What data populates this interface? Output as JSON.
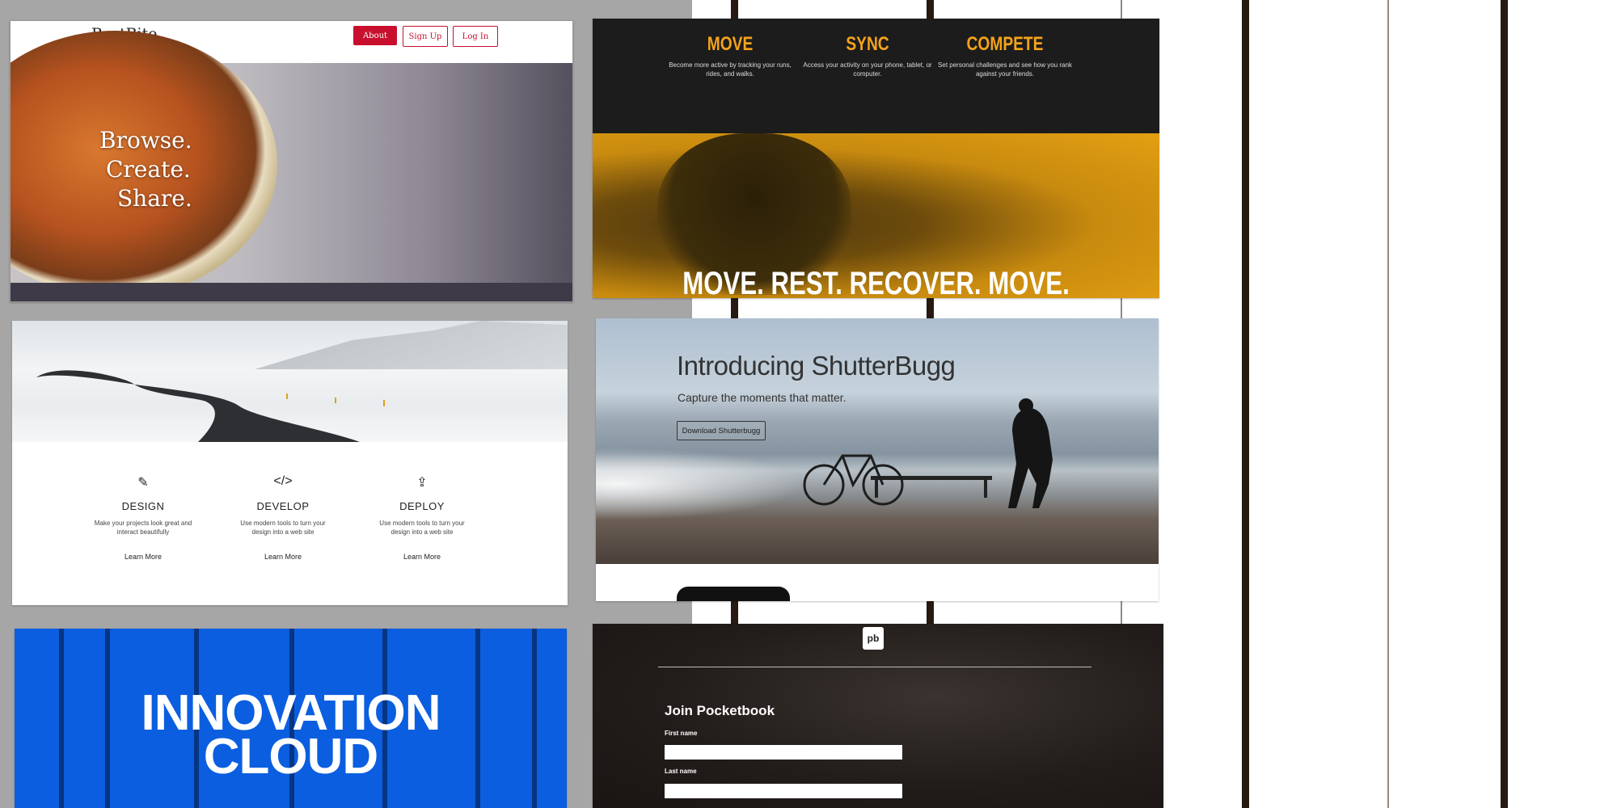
{
  "bestbite": {
    "brand": "BestBite",
    "nav": {
      "about": "About",
      "signup": "Sign Up",
      "login": "Log In"
    },
    "slogan": [
      "Browse.",
      "Create.",
      "Share."
    ]
  },
  "fitness": {
    "features": [
      {
        "title": "MOVE",
        "desc": "Become more active by tracking your runs, rides, and walks."
      },
      {
        "title": "SYNC",
        "desc": "Access your activity on your phone, tablet, or computer."
      },
      {
        "title": "COMPETE",
        "desc": "Set personal challenges and see how you rank against your friends."
      }
    ],
    "tagline": "MOVE. REST. RECOVER. MOVE."
  },
  "devsite": {
    "columns": [
      {
        "icon": "pencil-icon",
        "glyph": "✎",
        "title": "DESIGN",
        "desc": "Make your projects look great and interact beautifully",
        "link": "Learn More"
      },
      {
        "icon": "code-icon",
        "glyph": "</>",
        "title": "DEVELOP",
        "desc": "Use modern tools to turn your design into a web site",
        "link": "Learn More"
      },
      {
        "icon": "upload-icon",
        "glyph": "⇪",
        "title": "DEPLOY",
        "desc": "Use modern tools to turn your design into a web site",
        "link": "Learn More"
      }
    ]
  },
  "shutterbugg": {
    "title": "Introducing ShutterBugg",
    "subtitle": "Capture the moments that matter.",
    "download": "Download Shutterbugg"
  },
  "innovation": {
    "title_line1": "INNOVATION",
    "title_line2": "CLOUD"
  },
  "pocketbook": {
    "logo": "pb",
    "heading": "Join Pocketbook",
    "first_name_label": "First name",
    "last_name_label": "Last name",
    "first_name_value": "",
    "last_name_value": ""
  },
  "colors": {
    "bestbite_accent": "#c8102e",
    "fitness_accent": "#f5a31b",
    "innovation_blue": "#0b5ee0"
  }
}
